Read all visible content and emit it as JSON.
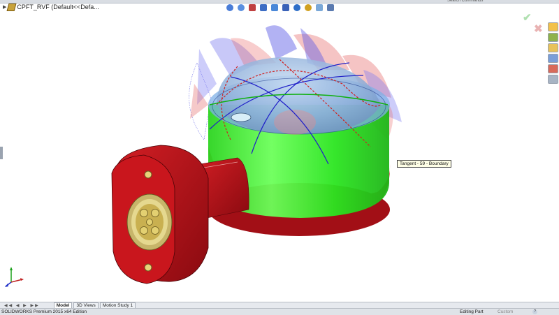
{
  "header": {
    "document_label": "CPFT_RVF  (Default<<Defa...",
    "search_placeholder": "Search Commands"
  },
  "tooltip": {
    "text": "Tangent - 59 - Boundary"
  },
  "tabs": [
    {
      "label": "Model",
      "active": true
    },
    {
      "label": "3D Views",
      "active": false
    },
    {
      "label": "Motion Study 1",
      "active": false
    }
  ],
  "status": {
    "product": "SOLIDWORKS Premium 2015 x64 Edition",
    "mode": "Editing Part",
    "units": "Custom"
  },
  "colors": {
    "body_red": "#b3121a",
    "band_green": "#2ee82a",
    "dome_blue": "#8fb6e8",
    "curv_blue": "#2a2ae0",
    "curv_red": "#e02a2a"
  }
}
